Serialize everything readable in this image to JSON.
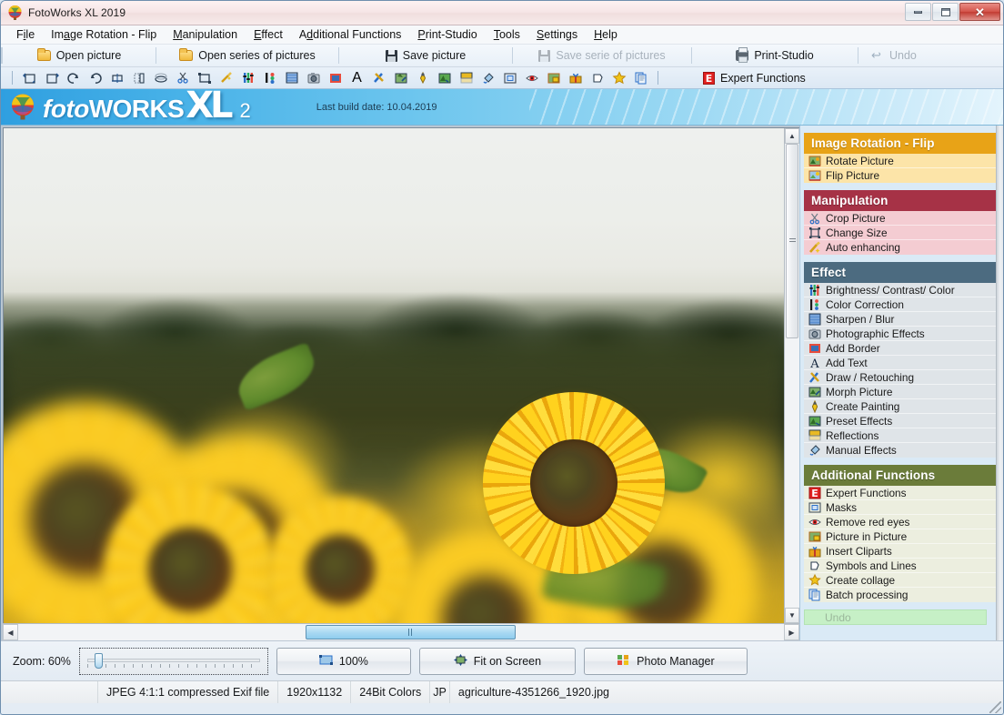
{
  "window": {
    "title": "FotoWorks XL 2019",
    "app_icon": "balloon-icon",
    "controls": {
      "minimize": "–",
      "maximize": "□",
      "close": "✕"
    }
  },
  "menubar": {
    "items": [
      {
        "label": "File",
        "accel": "i"
      },
      {
        "label": "Image Rotation - Flip",
        "accel": "a"
      },
      {
        "label": "Manipulation",
        "accel": "M"
      },
      {
        "label": "Effect",
        "accel": "E"
      },
      {
        "label": "Additional Functions",
        "accel": "d"
      },
      {
        "label": "Print-Studio",
        "accel": "P"
      },
      {
        "label": "Tools",
        "accel": "T"
      },
      {
        "label": "Settings",
        "accel": "S"
      },
      {
        "label": "Help",
        "accel": "H"
      }
    ]
  },
  "toolbar_main": {
    "buttons": [
      {
        "label": "Open picture",
        "icon": "folder-icon",
        "disabled": false
      },
      {
        "label": "Open series of pictures",
        "icon": "folder-icon",
        "disabled": false
      },
      {
        "label": "Save picture",
        "icon": "floppy-disk-icon",
        "disabled": false
      },
      {
        "label": "Save serie of pictures",
        "icon": "floppy-disk-icon",
        "disabled": true
      },
      {
        "label": "Print-Studio",
        "icon": "printer-icon",
        "disabled": false
      },
      {
        "label": "Undo",
        "icon": "undo-arrow-icon",
        "disabled": true
      }
    ]
  },
  "toolbar_icons": {
    "icons": [
      "rotate-left-icon",
      "rotate-right-icon",
      "rotate-cw-icon",
      "rotate-ccw-icon",
      "flip-horizontal-icon",
      "flip-vertical-icon",
      "perspective-icon",
      "crop-scissors-icon",
      "change-size-icon",
      "auto-enhance-wand-icon",
      "brightness-contrast-icon",
      "color-correction-icon",
      "sharpen-blur-icon",
      "photographic-effects-icon",
      "add-border-icon",
      "add-text-icon",
      "draw-retouching-icon",
      "morph-picture-icon",
      "create-painting-icon",
      "preset-effects-icon",
      "reflections-icon",
      "manual-effects-icon",
      "masks-icon",
      "remove-red-eyes-icon",
      "picture-in-picture-icon",
      "insert-cliparts-icon",
      "symbols-and-lines-icon",
      "create-collage-icon",
      "batch-processing-icon"
    ],
    "expert_button": {
      "label": "Expert Functions",
      "icon": "expert-e-icon"
    }
  },
  "banner": {
    "logo_foto": "foto",
    "logo_works": "WORKS",
    "logo_xl": "XL",
    "logo_version": "2",
    "build_label": "Last build date: 10.04.2019"
  },
  "sidebar": {
    "groups": [
      {
        "title": "Image Rotation - Flip",
        "header_color": "#e8a317",
        "item_bg": "#fce4a8",
        "items": [
          {
            "label": "Rotate Picture",
            "icon": "rotate-picture-icon"
          },
          {
            "label": "Flip Picture",
            "icon": "flip-picture-icon"
          }
        ]
      },
      {
        "title": "Manipulation",
        "header_color": "#a63246",
        "item_bg": "#f4ccd2",
        "items": [
          {
            "label": "Crop Picture",
            "icon": "scissors-icon"
          },
          {
            "label": "Change Size",
            "icon": "resize-icon"
          },
          {
            "label": "Auto enhancing",
            "icon": "magic-wand-icon"
          }
        ]
      },
      {
        "title": "Effect",
        "header_color": "#4c6b80",
        "item_bg": "#dfe4e8",
        "items": [
          {
            "label": "Brightness/ Contrast/ Color",
            "icon": "brightness-contrast-icon"
          },
          {
            "label": "Color Correction",
            "icon": "color-correction-icon"
          },
          {
            "label": "Sharpen / Blur",
            "icon": "sharpen-blur-icon"
          },
          {
            "label": "Photographic Effects",
            "icon": "camera-icon"
          },
          {
            "label": "Add Border",
            "icon": "add-border-icon"
          },
          {
            "label": "Add Text",
            "icon": "add-text-icon"
          },
          {
            "label": "Draw / Retouching",
            "icon": "draw-retouching-icon"
          },
          {
            "label": "Morph Picture",
            "icon": "morph-picture-icon"
          },
          {
            "label": "Create Painting",
            "icon": "paint-brush-icon"
          },
          {
            "label": "Preset Effects",
            "icon": "preset-effects-icon"
          },
          {
            "label": "Reflections",
            "icon": "reflections-icon"
          },
          {
            "label": "Manual Effects",
            "icon": "paint-bucket-icon"
          }
        ]
      },
      {
        "title": "Additional Functions",
        "header_color": "#6b7c3a",
        "item_bg": "#eceedf",
        "items": [
          {
            "label": "Expert Functions",
            "icon": "expert-e-icon"
          },
          {
            "label": "Masks",
            "icon": "masks-icon"
          },
          {
            "label": "Remove red eyes",
            "icon": "red-eye-icon"
          },
          {
            "label": "Picture in Picture",
            "icon": "picture-in-picture-icon"
          },
          {
            "label": "Insert Cliparts",
            "icon": "gift-clipart-icon"
          },
          {
            "label": "Symbols and Lines",
            "icon": "symbols-lines-icon"
          },
          {
            "label": "Create collage",
            "icon": "star-collage-icon"
          },
          {
            "label": "Batch processing",
            "icon": "batch-processing-icon"
          }
        ]
      }
    ],
    "undo_button": {
      "label": "Undo",
      "disabled": true
    }
  },
  "canvas": {
    "image_description": "sunflower-field-photo",
    "vertical_scrollbar": {
      "thumb_position_pct": 0,
      "thumb_size_pct": 42
    },
    "horizontal_scrollbar": {
      "thumb_position_pct": 37.5,
      "thumb_size_pct": 27.5
    }
  },
  "bottombar": {
    "zoom_label": "Zoom: 60%",
    "zoom_value": 60,
    "buttons": [
      {
        "label": "100%",
        "icon": "actual-size-icon"
      },
      {
        "label": "Fit on Screen",
        "icon": "fit-screen-icon"
      },
      {
        "label": "Photo Manager",
        "icon": "photo-manager-icon"
      }
    ]
  },
  "statusbar": {
    "cells": [
      "JPEG 4:1:1 compressed Exif file",
      "1920x1132",
      "24Bit Colors",
      "JP",
      "agriculture-4351266_1920.jpg"
    ]
  }
}
